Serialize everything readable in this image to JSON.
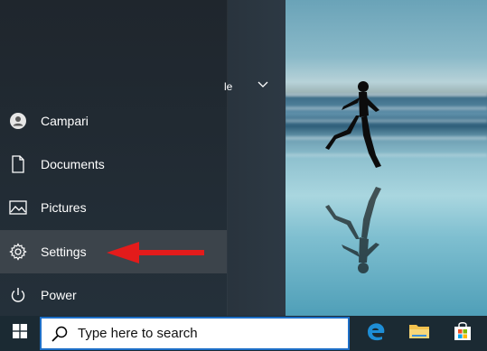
{
  "start_menu": {
    "partial_label": "le",
    "items": [
      {
        "label": "Campari",
        "icon": "user-icon"
      },
      {
        "label": "Documents",
        "icon": "document-icon"
      },
      {
        "label": "Pictures",
        "icon": "pictures-icon"
      },
      {
        "label": "Settings",
        "icon": "gear-icon",
        "active": true
      },
      {
        "label": "Power",
        "icon": "power-icon"
      }
    ]
  },
  "taskbar": {
    "search_placeholder": "Type here to search",
    "apps": [
      "edge-icon",
      "file-explorer-icon",
      "store-icon"
    ]
  },
  "colors": {
    "accent_arrow": "#e31b1b",
    "search_border": "#1e6fc7",
    "edge_blue": "#1e8ed6",
    "folder_yellow": "#f2c14e"
  }
}
